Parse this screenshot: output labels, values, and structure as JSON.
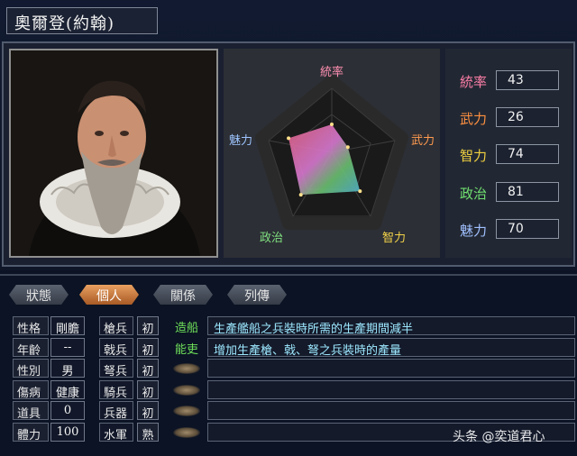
{
  "character": {
    "name": "奧爾登(約翰)"
  },
  "tabs": [
    "狀態",
    "個人",
    "關係",
    "列傳"
  ],
  "active_tab": 1,
  "radar": {
    "labels": [
      "統率",
      "武力",
      "智力",
      "政治",
      "魅力"
    ]
  },
  "stats": [
    {
      "label": "統率",
      "value": "43",
      "color": "#ff7fa8"
    },
    {
      "label": "武力",
      "value": "26",
      "color": "#ff9040"
    },
    {
      "label": "智力",
      "value": "74",
      "color": "#f0d040"
    },
    {
      "label": "政治",
      "value": "81",
      "color": "#70e070"
    },
    {
      "label": "魅力",
      "value": "70",
      "color": "#a0c0ff"
    }
  ],
  "personal": [
    {
      "label": "性格",
      "value": "剛膽"
    },
    {
      "label": "年齡",
      "value": "--"
    },
    {
      "label": "性別",
      "value": "男"
    },
    {
      "label": "傷病",
      "value": "健康"
    },
    {
      "label": "道具",
      "value": "0"
    },
    {
      "label": "體力",
      "value": "100"
    }
  ],
  "troops": [
    {
      "label": "槍兵",
      "rank": "初"
    },
    {
      "label": "戟兵",
      "rank": "初"
    },
    {
      "label": "弩兵",
      "rank": "初"
    },
    {
      "label": "騎兵",
      "rank": "初"
    },
    {
      "label": "兵器",
      "rank": "初"
    },
    {
      "label": "水軍",
      "rank": "熟"
    }
  ],
  "skills": [
    {
      "name": "造船",
      "desc": "生產艦船之兵裝時所需的生產期間減半"
    },
    {
      "name": "能吏",
      "desc": "增加生產槍、戟、弩之兵裝時的產量"
    },
    {
      "name": "",
      "desc": ""
    },
    {
      "name": "",
      "desc": ""
    },
    {
      "name": "",
      "desc": ""
    },
    {
      "name": "",
      "desc": ""
    }
  ],
  "watermark": "头条 @奕道君心"
}
